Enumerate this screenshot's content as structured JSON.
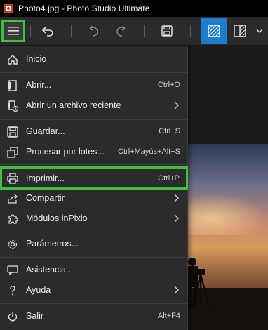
{
  "window": {
    "title": "Photo4.jpg - Photo Studio Ultimate"
  },
  "toolbar": {
    "buttons": [
      {
        "name": "menu",
        "icon": "hamburger-icon"
      },
      {
        "name": "back",
        "icon": "arrow-back-icon"
      },
      {
        "name": "undo",
        "icon": "undo-icon"
      },
      {
        "name": "redo",
        "icon": "redo-icon"
      },
      {
        "name": "save",
        "icon": "save-icon"
      },
      {
        "name": "view-single",
        "icon": "hatched-square-icon",
        "active": true
      },
      {
        "name": "view-compare",
        "icon": "split-view-icon"
      },
      {
        "name": "more",
        "icon": "chevron-down-icon"
      }
    ]
  },
  "menu": {
    "items": [
      {
        "label": "Inicio",
        "shortcut": "",
        "submenu": false,
        "icon": "home-icon"
      },
      {
        "label": "Abrir...",
        "shortcut": "Ctrl+O",
        "submenu": false,
        "icon": "open-file-icon"
      },
      {
        "label": "Abrir un archivo reciente",
        "shortcut": "",
        "submenu": true,
        "icon": "recent-file-icon"
      },
      {
        "label": "Guardar...",
        "shortcut": "Ctrl+S",
        "submenu": false,
        "icon": "save-icon"
      },
      {
        "label": "Procesar por lotes...",
        "shortcut": "Ctrl+Mayús+Alt+S",
        "submenu": false,
        "icon": "batch-icon"
      },
      {
        "label": "Imprimir...",
        "shortcut": "Ctrl+P",
        "submenu": false,
        "icon": "printer-icon",
        "highlighted": true
      },
      {
        "label": "Compartir",
        "shortcut": "",
        "submenu": true,
        "icon": "share-icon"
      },
      {
        "label": "Módulos inPixio",
        "shortcut": "",
        "submenu": true,
        "icon": "puzzle-icon"
      },
      {
        "label": "Parámetros...",
        "shortcut": "",
        "submenu": false,
        "icon": "gear-icon"
      },
      {
        "label": "Asistencia...",
        "shortcut": "",
        "submenu": false,
        "icon": "chat-icon"
      },
      {
        "label": "Ayuda",
        "shortcut": "",
        "submenu": true,
        "icon": "question-icon"
      },
      {
        "label": "Salir",
        "shortcut": "Alt+F4",
        "submenu": false,
        "icon": "power-icon"
      }
    ]
  },
  "colors": {
    "accent": "#1d7ed1",
    "highlight": "#3ec23e",
    "menu_bg": "#2b2b2b"
  }
}
